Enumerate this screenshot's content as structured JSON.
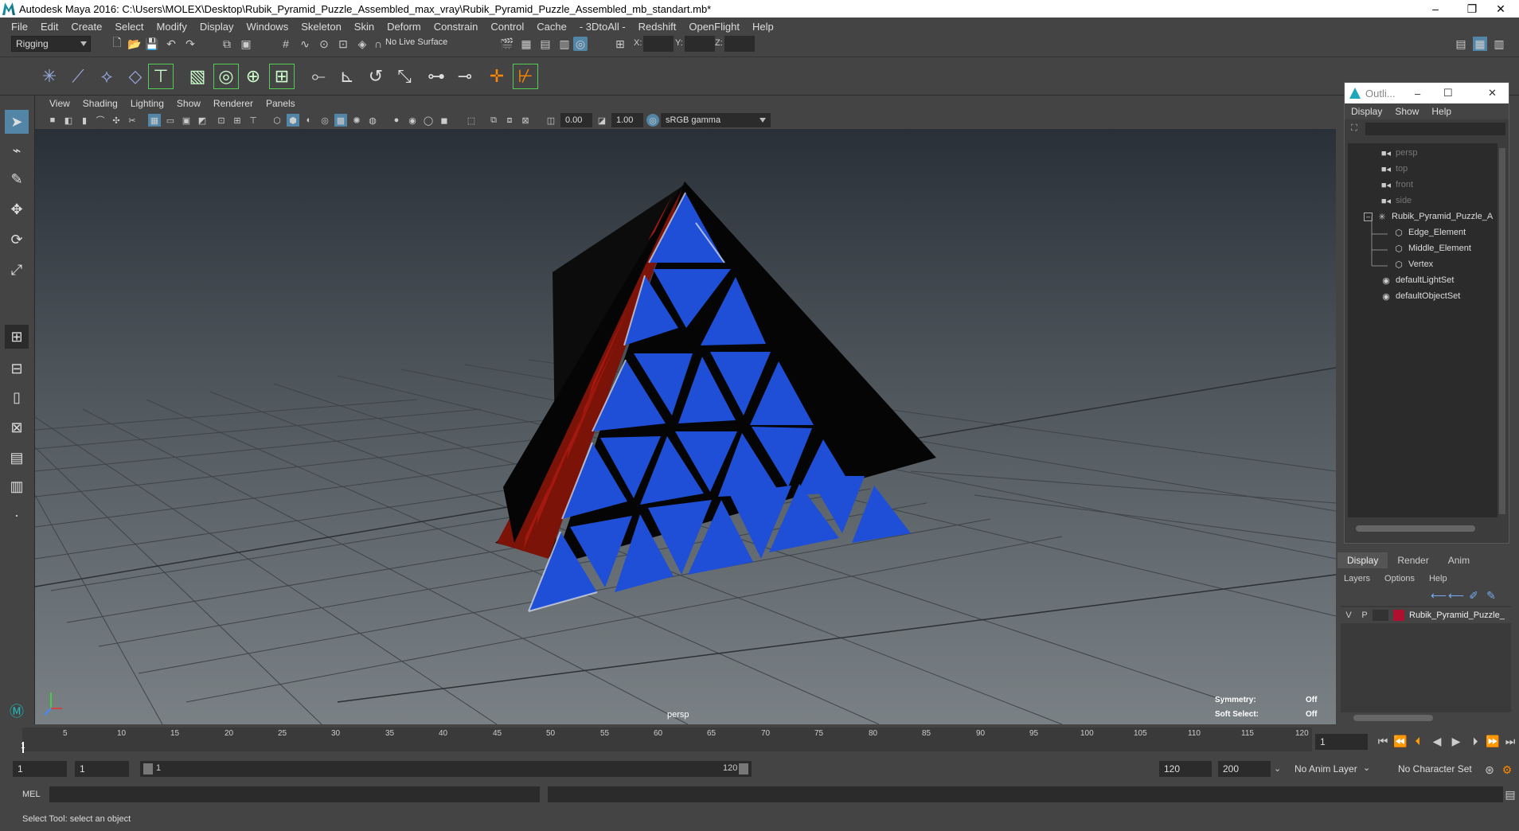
{
  "window": {
    "title": "Autodesk Maya 2016: C:\\Users\\MOLEX\\Desktop\\Rubik_Pyramid_Puzzle_Assembled_max_vray\\Rubik_Pyramid_Puzzle_Assembled_mb_standart.mb*",
    "minimize": "–",
    "restore": "❐",
    "close": "✕"
  },
  "menubar": [
    "File",
    "Edit",
    "Create",
    "Select",
    "Modify",
    "Display",
    "Windows",
    "Skeleton",
    "Skin",
    "Deform",
    "Constrain",
    "Control",
    "Cache",
    "- 3DtoAll -",
    "Redshift",
    "OpenFlight",
    "Help"
  ],
  "statusline": {
    "menuset": "Rigging",
    "live_surface": "No Live Surface",
    "x_label": "X:",
    "y_label": "Y:",
    "z_label": "Z:"
  },
  "viewport": {
    "menu": [
      "View",
      "Shading",
      "Lighting",
      "Show",
      "Renderer",
      "Panels"
    ],
    "exposure": "0.00",
    "gamma": "1.00",
    "color_space": "sRGB gamma",
    "camera_label": "persp",
    "hud": {
      "symmetry_label": "Symmetry:",
      "symmetry_value": "Off",
      "soft_select_label": "Soft Select:",
      "soft_select_value": "Off"
    }
  },
  "outliner": {
    "title": "Outli...",
    "menu": [
      "Display",
      "Show",
      "Help"
    ],
    "items": [
      {
        "label": "persp",
        "dim": true,
        "icon": "camera-icon",
        "indent": 0
      },
      {
        "label": "top",
        "dim": true,
        "icon": "camera-icon",
        "indent": 0
      },
      {
        "label": "front",
        "dim": true,
        "icon": "camera-icon",
        "indent": 0
      },
      {
        "label": "side",
        "dim": true,
        "icon": "camera-icon",
        "indent": 0
      },
      {
        "label": "Rubik_Pyramid_Puzzle_A",
        "dim": false,
        "icon": "group-icon",
        "indent": 0
      },
      {
        "label": "Edge_Element",
        "dim": false,
        "icon": "mesh-icon",
        "indent": 1
      },
      {
        "label": "Middle_Element",
        "dim": false,
        "icon": "mesh-icon",
        "indent": 1
      },
      {
        "label": "Vertex",
        "dim": false,
        "icon": "mesh-icon",
        "indent": 1
      },
      {
        "label": "defaultLightSet",
        "dim": false,
        "icon": "set-icon",
        "indent": 0
      },
      {
        "label": "defaultObjectSet",
        "dim": false,
        "icon": "set-icon",
        "indent": 0
      }
    ]
  },
  "layers": {
    "tabs": [
      "Display",
      "Render",
      "Anim"
    ],
    "menu": [
      "Layers",
      "Options",
      "Help"
    ],
    "row": {
      "v": "V",
      "p": "P",
      "name": "Rubik_Pyramid_Puzzle_",
      "color": "#b01030"
    }
  },
  "timeline": {
    "ticks": [
      "5",
      "10",
      "15",
      "20",
      "25",
      "30",
      "35",
      "40",
      "45",
      "50",
      "55",
      "60",
      "65",
      "70",
      "75",
      "80",
      "85",
      "90",
      "95",
      "100",
      "105",
      "110",
      "115",
      "120"
    ],
    "start_marker": "1",
    "current_frame": "1"
  },
  "range": {
    "start": "1",
    "playback_start": "1",
    "slider_start": "1",
    "slider_end": "120",
    "playback_end": "120",
    "end": "200",
    "anim_layer": "No Anim Layer",
    "character_set": "No Character Set"
  },
  "cmdline": {
    "label": "MEL"
  },
  "helpline": {
    "text": "Select Tool: select an object"
  },
  "colors": {
    "face_blue": "#1f4fd6",
    "face_red": "#a3180f",
    "ui_bg": "#444444",
    "accent": "#5285a6"
  }
}
